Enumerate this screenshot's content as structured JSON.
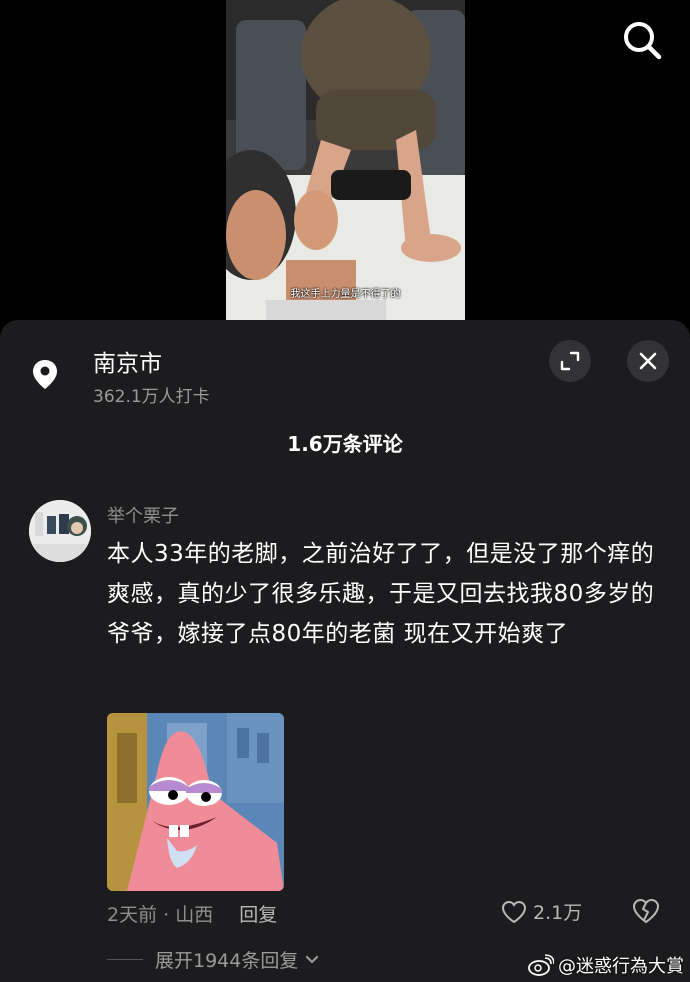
{
  "video": {
    "subtitle": "我这手上力量是不得了的"
  },
  "header": {
    "search_icon": "search-icon"
  },
  "location": {
    "icon": "location-pin-icon",
    "city": "南京市",
    "checkins": "362.1万人打卡"
  },
  "controls": {
    "expand_icon": "expand-icon",
    "close_icon": "close-icon"
  },
  "comments": {
    "count_label": "1.6万条评论"
  },
  "comment": {
    "username": "举个栗子",
    "text": "本人33年的老脚，之前治好了了，但是没了那个痒的爽感，真的少了很多乐趣，于是又回去找我80多岁的爷爷，嫁接了点80年的老菌 现在又开始爽了",
    "time_location": "2天前 · 山西",
    "reply_label": "回复",
    "like_count": "2.1万",
    "expand_replies": "展开1944条回复"
  },
  "watermark": {
    "text": "@迷惑行為大賞"
  },
  "colors": {
    "background": "#000000",
    "sheet": "#1c1c1e",
    "secondary_text": "#8e8e8e",
    "button_bg": "#333336"
  }
}
